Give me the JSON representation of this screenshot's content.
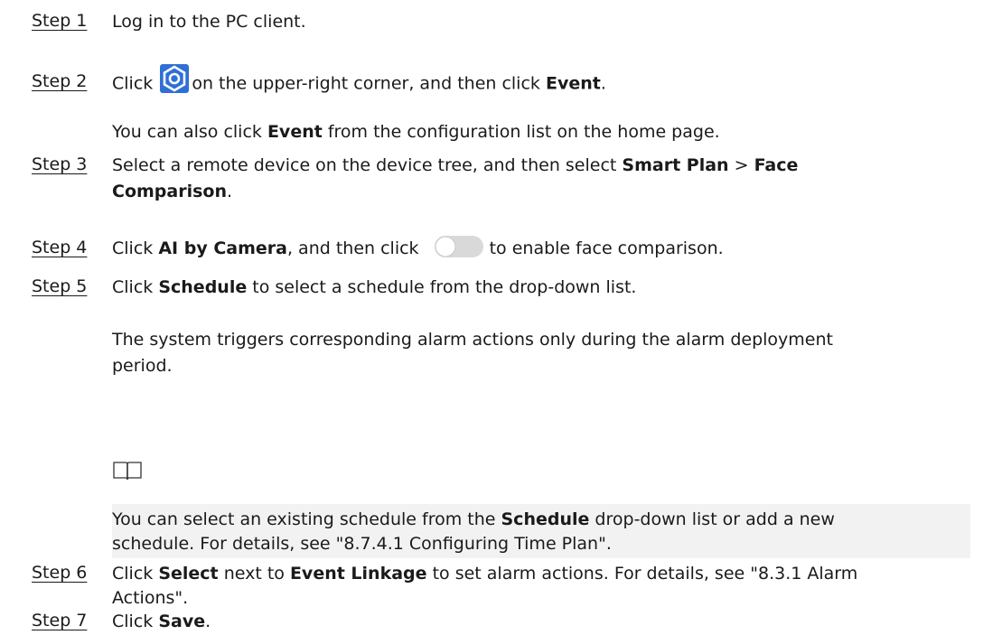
{
  "steps": [
    {
      "label": "Step 1",
      "text": "Log in to the PC client."
    },
    {
      "label": "Step 2",
      "pre": "Click",
      "post": "on the upper-right corner, and then click",
      "bold": "Event",
      "end": ".",
      "icon": "gear-icon",
      "sub": {
        "pre": "You can also click",
        "bold": "Event",
        "post": " from the configuration list on the home page."
      }
    },
    {
      "label": "Step 3",
      "pre": "Select a remote device on the device tree, and then select",
      "bold1": "Smart Plan",
      "sep": " > ",
      "bold2a": "Face",
      "bold2b": "Comparison",
      "end": "."
    },
    {
      "label": "Step 4",
      "pre": "Click",
      "bold": "AI by Camera",
      "mid": ", and then click",
      "post": "to enable face comparison.",
      "icon": "toggle-icon"
    },
    {
      "label": "Step 5",
      "pre": "Click",
      "bold": "Schedule",
      "post": " to select a schedule from the drop-down list.",
      "sub1": "The system triggers corresponding alarm actions only during the alarm deployment",
      "sub1b": "period.",
      "note_icon": "book-icon",
      "note": {
        "pre": "You can select an existing schedule from the",
        "bold": "Schedule",
        "post": " drop-down list or add a new",
        "line2": "schedule. For details, see \"8.7.4.1 Configuring Time Plan\"."
      }
    },
    {
      "label": "Step 6",
      "pre": "Click",
      "bold1": "Select",
      "mid": " next to",
      "bold2": "Event Linkage",
      "post": "to set alarm actions. For details, see \"8.3.1 Alarm",
      "line2": "Actions\"."
    },
    {
      "label": "Step 7",
      "pre": "Click",
      "bold": "Save",
      "end": "."
    }
  ],
  "colors": {
    "gear_icon": "#2f6fd6",
    "toggle_track": "#d9d9d9",
    "note_bg": "#f2f2f2"
  }
}
